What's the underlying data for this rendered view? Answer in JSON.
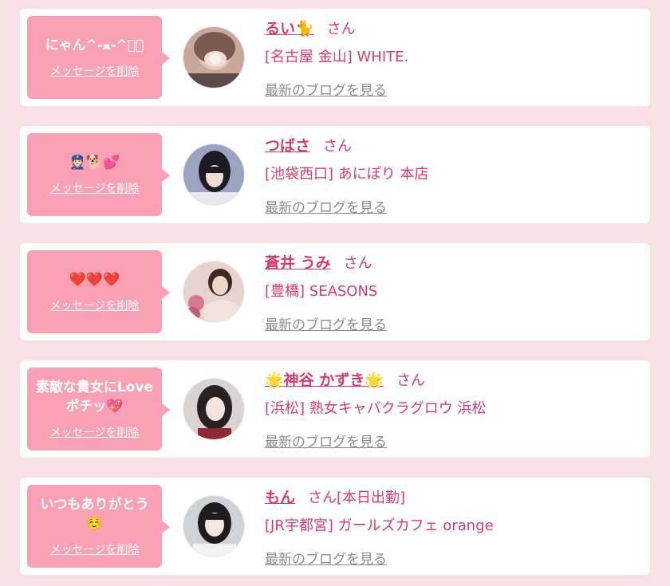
{
  "common": {
    "delete_label": "メッセージを削除",
    "blog_label": "最新のブログを見る",
    "san": "さん"
  },
  "cards": [
    {
      "message": "にゃん^-ﻌ-^ฅ゙",
      "name": "るい🐈",
      "extra": "",
      "shop": "[名古屋 金山] WHITE."
    },
    {
      "message": "👮🏻🐕💕",
      "name": "つばさ",
      "extra": "",
      "shop": "[池袋西口] あにぽり 本店"
    },
    {
      "message": "❤️❤️❤️",
      "name": "蒼井 うみ",
      "extra": "",
      "shop": "[豊橋] SEASONS"
    },
    {
      "message": "素敵な貴女にLove\nポチッ💖",
      "name": "🌟神谷 かずき🌟",
      "extra": "",
      "shop": "[浜松] 熟女キャバクラグロウ 浜松"
    },
    {
      "message": "いつもありがとう\n☺️",
      "name": "もん",
      "extra": "[本日出勤]",
      "shop": "[JR宇都宮] ガールズカフェ orange"
    }
  ]
}
